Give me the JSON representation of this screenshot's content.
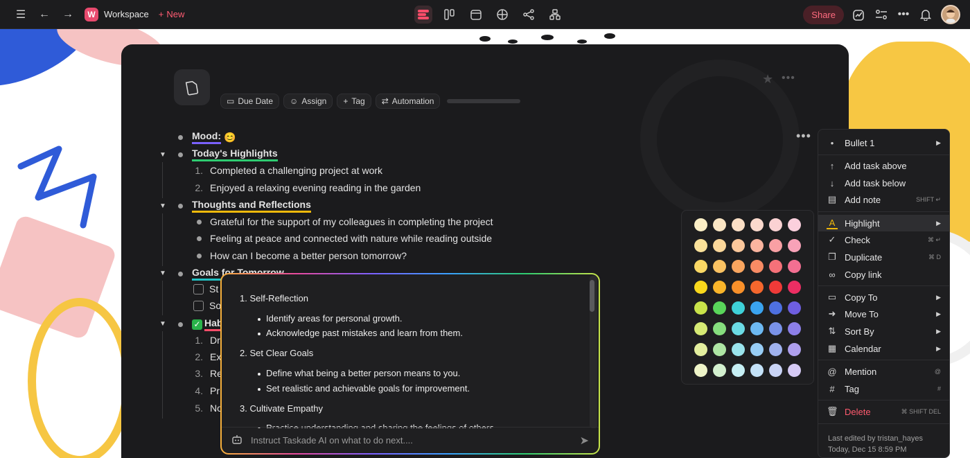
{
  "topbar": {
    "workspace_initial": "W",
    "workspace_name": "Workspace",
    "new_label": "New",
    "share_label": "Share"
  },
  "toolbar": {
    "chips": [
      "Due Date",
      "Assign",
      "Tag",
      "Automation"
    ]
  },
  "outline": {
    "mood_label": "Mood:",
    "mood_emoji": "😊",
    "highlights_title": "Today's Highlights",
    "highlights": [
      "Completed a challenging project at work",
      "Enjoyed a relaxing evening reading in the garden"
    ],
    "thoughts_title": "Thoughts and Reflections",
    "thoughts": [
      "Grateful for the support of my colleagues in completing the project",
      "Feeling at peace and connected with nature while reading outside",
      "How can I become a better person tomorrow?"
    ],
    "goals_title": "Goals for Tomorrow",
    "goals": [
      "St",
      "So"
    ],
    "habits_title": "Hab",
    "habits": [
      "Dr",
      "Ex",
      "Re",
      "Pr",
      "No"
    ]
  },
  "ai_panel": {
    "lines": [
      {
        "type": "num",
        "text": "1. Self-Reflection"
      },
      {
        "type": "bullet",
        "text": "Identify areas for personal growth."
      },
      {
        "type": "bullet",
        "text": "Acknowledge past mistakes and learn from them."
      },
      {
        "type": "num",
        "text": "2. Set Clear Goals"
      },
      {
        "type": "bullet",
        "text": "Define what being a better person means to you."
      },
      {
        "type": "bullet",
        "text": "Set realistic and achievable goals for improvement."
      },
      {
        "type": "num",
        "text": "3. Cultivate Empathy"
      },
      {
        "type": "bullet",
        "text": "Practice understanding and sharing the feelings of others."
      }
    ],
    "input_placeholder": "Instruct Taskade AI on what to do next...."
  },
  "palette": {
    "rows": [
      [
        "#fbefc6",
        "#fbe6c4",
        "#fbdfc6",
        "#fbd9cd",
        "#fbd2d3",
        "#fbd0dd"
      ],
      [
        "#fbe29a",
        "#fbd79a",
        "#fbc79b",
        "#fbb49f",
        "#f9a0a4",
        "#f8a2b8"
      ],
      [
        "#fad865",
        "#fac262",
        "#f9a55f",
        "#f88b64",
        "#f57179",
        "#f36f92"
      ],
      [
        "#f9d81c",
        "#f9b52a",
        "#f8902a",
        "#f5672d",
        "#ef3a38",
        "#ec2e63"
      ],
      [
        "#c9e34a",
        "#59d55a",
        "#3ed1d8",
        "#3aa4f0",
        "#4e70e0",
        "#6e5ee0"
      ],
      [
        "#d6ea74",
        "#86de7e",
        "#6bdbe4",
        "#6db9f2",
        "#7a92e8",
        "#8c7fe8"
      ],
      [
        "#e3ee9e",
        "#aee6a4",
        "#9ae4ec",
        "#98cdf5",
        "#a0b2ee",
        "#ae9fed"
      ],
      [
        "#eef4c8",
        "#d3f0cf",
        "#c6eff4",
        "#c4e2f8",
        "#c9d3f5",
        "#d5caf5"
      ]
    ]
  },
  "menu": {
    "bullet_label": "Bullet 1",
    "add_task_above": "Add task above",
    "add_task_below": "Add task below",
    "add_note": "Add note",
    "add_note_sc": "SHIFT ↵",
    "highlight": "Highlight",
    "check": "Check",
    "check_sc": "⌘ ↵",
    "duplicate": "Duplicate",
    "duplicate_sc": "⌘ D",
    "copy_link": "Copy link",
    "copy_to": "Copy To",
    "move_to": "Move To",
    "sort_by": "Sort By",
    "calendar": "Calendar",
    "mention": "Mention",
    "mention_sc": "@",
    "tag": "Tag",
    "tag_sc": "#",
    "delete": "Delete",
    "delete_sc": "⌘ SHIFT DEL",
    "last_edited": "Last edited by tristan_hayes",
    "last_edited_time": "Today, Dec 15 8:59 PM"
  }
}
